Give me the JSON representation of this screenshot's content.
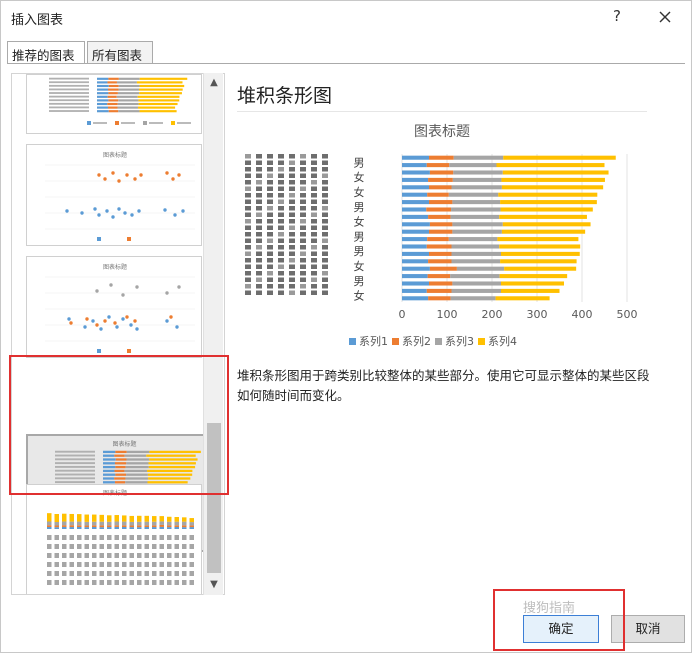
{
  "dialog": {
    "title": "插入图表",
    "help_label": "?",
    "tabs": [
      {
        "label": "推荐的图表"
      },
      {
        "label": "所有图表"
      }
    ]
  },
  "preview": {
    "chart_type_name": "堆积条形图",
    "description": "堆积条形图用于跨类别比较整体的某些部分。使用它可显示整体的某些区段如何随时间而变化。"
  },
  "chart_data": {
    "type": "bar",
    "orientation": "horizontal",
    "stacked": true,
    "title": "图表标题",
    "category_labels": [
      "男",
      "女",
      "女",
      "男",
      "女",
      "男",
      "男",
      "女",
      "男",
      "女"
    ],
    "rows": 20,
    "xlim": [
      0,
      500
    ],
    "xticks": [
      0,
      100,
      200,
      300,
      400,
      500
    ],
    "series": [
      {
        "name": "系列1",
        "color": "#5b9bd5",
        "values": [
          60,
          55,
          62,
          58,
          60,
          56,
          60,
          54,
          58,
          62,
          60,
          56,
          55,
          60,
          58,
          62,
          57,
          60,
          55,
          58
        ]
      },
      {
        "name": "系列2",
        "color": "#ed7d31",
        "values": [
          55,
          50,
          52,
          55,
          50,
          48,
          52,
          55,
          50,
          50,
          52,
          48,
          55,
          50,
          52,
          60,
          50,
          52,
          55,
          50
        ]
      },
      {
        "name": "系列3",
        "color": "#a5a5a5",
        "values": [
          110,
          105,
          110,
          108,
          112,
          110,
          106,
          110,
          108,
          112,
          110,
          108,
          106,
          110,
          108,
          105,
          110,
          108,
          110,
          100
        ]
      },
      {
        "name": "系列4",
        "color": "#ffc000",
        "values": [
          250,
          240,
          235,
          230,
          225,
          220,
          215,
          205,
          195,
          195,
          185,
          180,
          180,
          175,
          170,
          160,
          150,
          140,
          130,
          120
        ]
      }
    ],
    "legend_position": "bottom",
    "grid": true
  },
  "buttons": {
    "ok": "确定",
    "cancel": "取消"
  },
  "watermark": "搜狗指南"
}
